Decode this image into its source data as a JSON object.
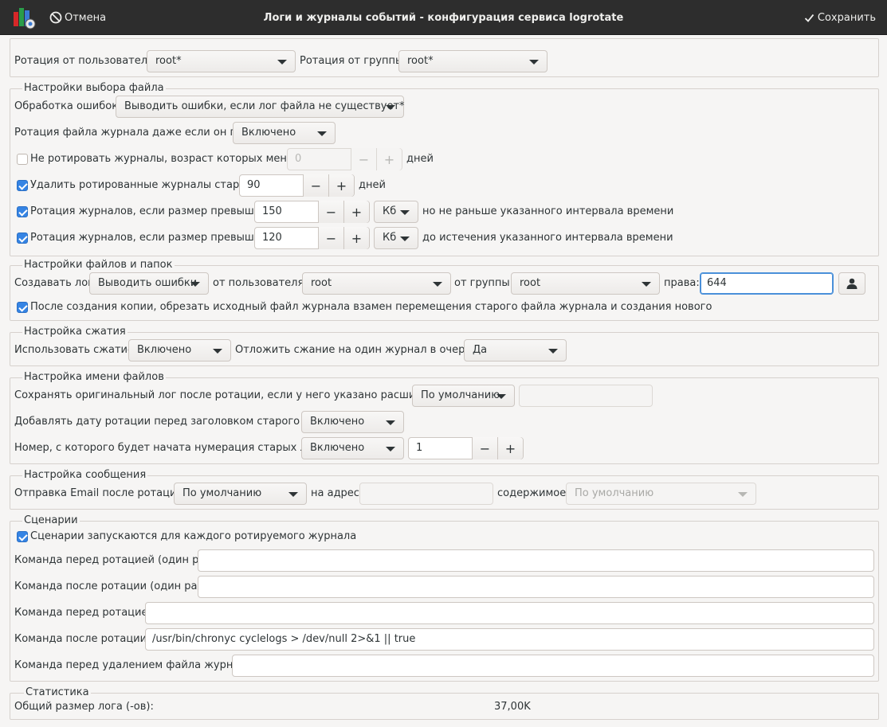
{
  "window": {
    "title": "Логи и журналы событий - конфигурация сервиса logrotate",
    "cancel_label": "Отмена",
    "save_label": "Сохранить"
  },
  "rotation_owner": {
    "user_label": "Ротация от пользователя:",
    "user_value": "root*",
    "group_label": "Ротация от группы:",
    "group_value": "root*"
  },
  "file_selection": {
    "legend": "Настройки выбора файла",
    "errors_label": "Обработка ошибок:",
    "errors_value": "Выводить ошибки, если лог файла не существует*",
    "empty_label": "Ротация файла журнала даже если он пуст:",
    "empty_value": "Включено",
    "min_age_label": "Не ротировать журналы, возраст которых меньше",
    "min_age_checked": false,
    "min_age_value": "0",
    "min_age_unit": "дней",
    "delete_label": "Удалить ротированные журналы старше",
    "delete_checked": true,
    "delete_value": "90",
    "delete_unit": "дней",
    "minsize_label": "Ротация журналов, если размер превышает",
    "minsize_checked": true,
    "minsize_value": "150",
    "minsize_unit": "Кб",
    "minsize_note": "но не раньше указанного интервала времени",
    "maxsize_label": "Ротация журналов, если размер превышает",
    "maxsize_checked": true,
    "maxsize_value": "120",
    "maxsize_unit": "Кб",
    "maxsize_note": "до истечения указанного интервала времени"
  },
  "files_folders": {
    "legend": "Настройки файлов и папок",
    "create_label": "Создавать лог",
    "create_value": "Выводить ошибки",
    "user_label": "от пользователя:",
    "user_value": "root",
    "group_label": "от группы:",
    "group_value": "root",
    "perm_label": "права:",
    "perm_value": "644",
    "copytruncate_label": "После создания копии, обрезать исходный файл журнала взамен перемещения старого файла журнала и создания нового",
    "copytruncate_checked": true
  },
  "compression": {
    "legend": "Настройка сжатия",
    "use_label": "Использовать сжатие:",
    "use_value": "Включено",
    "delay_label": "Отложить сжание на один журнал в очереди:",
    "delay_value": "Да"
  },
  "naming": {
    "legend": "Настройка имени файлов",
    "ext_label": "Сохранять оригинальный лог после ротации, если у него указано расширение:",
    "ext_value": "По умолчанию",
    "ext_field": "",
    "date_label": "Добавлять дату ротации перед заголовком старого лога:",
    "date_value": "Включено",
    "start_label": "Номер, с которого будет начата нумерация старых логов:",
    "start_value": "Включено",
    "start_number": "1"
  },
  "mail": {
    "legend": "Настройка сообщения",
    "send_label": "Отправка Email после ротации:",
    "send_value": "По умолчанию",
    "addr_label": "на адрес:",
    "addr_value": "",
    "content_label": "содержимое:",
    "content_value": "По умолчанию"
  },
  "scripts": {
    "legend": "Сценарии",
    "shared_label": "Сценарии запускаются для каждого ротируемого журнала",
    "shared_checked": true,
    "firstaction_label": "Команда перед ротацией (один раз):",
    "firstaction_value": "",
    "lastaction_label": "Команда после ротации (один раз):",
    "lastaction_value": "",
    "prerotate_label": "Команда перед ротацией:",
    "prerotate_value": "",
    "postrotate_label": "Команда после ротации:",
    "postrotate_value": "/usr/bin/chronyc cyclelogs > /dev/null 2>&1 || true",
    "preremove_label": "Команда перед удалением файла журнала:",
    "preremove_value": ""
  },
  "stats": {
    "legend": "Статистика",
    "size_label": "Общий размер лога (-ов):",
    "size_value": "37,00K"
  },
  "colors": {
    "titlebar": "#2d2d2d",
    "accent": "#3584e4",
    "background": "#f6f5f4"
  }
}
